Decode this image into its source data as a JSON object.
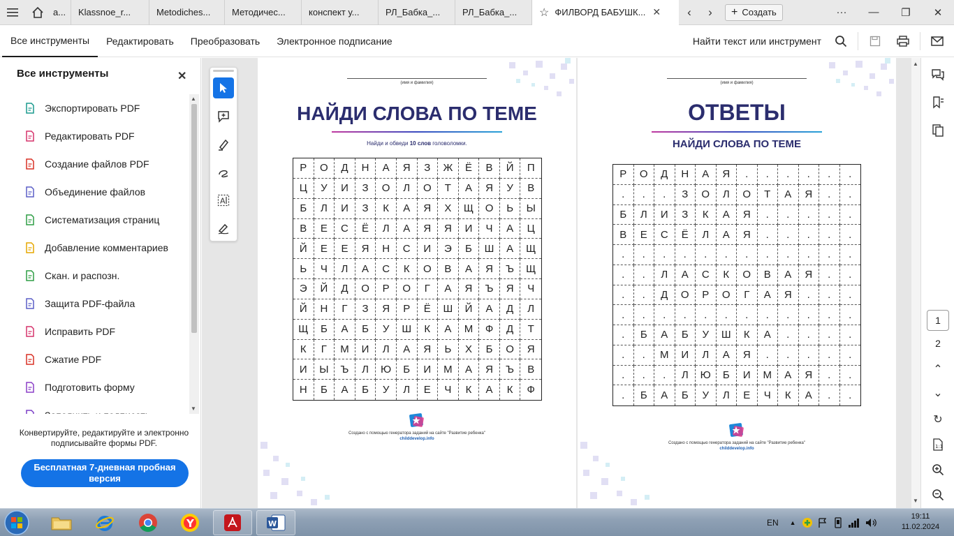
{
  "tabs": {
    "partial": "a...",
    "items": [
      "Klassnoe_r...",
      "Metodiches...",
      "Методичес...",
      "конспект у...",
      "РЛ_Бабка_...",
      "РЛ_Бабка_..."
    ],
    "active": "ФИЛВОРД БАБУШК...",
    "create": "Создать"
  },
  "menu": {
    "items": [
      "Все инструменты",
      "Редактировать",
      "Преобразовать",
      "Электронное подписание"
    ],
    "find": "Найти текст или инструмент"
  },
  "left_panel": {
    "title": "Все инструменты",
    "tools": [
      {
        "label": "Экспортировать PDF",
        "icon": "export-pdf-icon",
        "color": "#1a9a8e"
      },
      {
        "label": "Редактировать PDF",
        "icon": "edit-pdf-icon",
        "color": "#d6336c"
      },
      {
        "label": "Создание файлов PDF",
        "icon": "create-pdf-icon",
        "color": "#d93025"
      },
      {
        "label": "Объединение файлов",
        "icon": "combine-files-icon",
        "color": "#5b5fc7"
      },
      {
        "label": "Систематизация страниц",
        "icon": "organize-pages-icon",
        "color": "#2e9e45"
      },
      {
        "label": "Добавление комментариев",
        "icon": "comment-icon",
        "color": "#e6a700"
      },
      {
        "label": "Скан. и распозн.",
        "icon": "scan-ocr-icon",
        "color": "#2e9e45"
      },
      {
        "label": "Защита PDF-файла",
        "icon": "protect-pdf-icon",
        "color": "#5b5fc7"
      },
      {
        "label": "Исправить PDF",
        "icon": "redact-pdf-icon",
        "color": "#d6336c"
      },
      {
        "label": "Сжатие PDF",
        "icon": "compress-pdf-icon",
        "color": "#d93025"
      },
      {
        "label": "Подготовить форму",
        "icon": "prepare-form-icon",
        "color": "#8b3fc7"
      },
      {
        "label": "Заполнить и подписать",
        "icon": "fill-sign-icon",
        "color": "#7b3fc7"
      }
    ],
    "promo": "Конвертируйте, редактируйте и электронно подписывайте формы PDF.",
    "trial": "Бесплатная 7-дневная пробная версия"
  },
  "page1": {
    "name_caption": "(имя и фамилия)",
    "title": "НАЙДИ СЛОВА ПО ТЕМЕ",
    "instr_pre": "Найди и обведи ",
    "instr_bold": "10 слов",
    "instr_post": " головоломки.",
    "rows": [
      "РОДНАЯЗЖЁВЙП",
      "ЦУИЗОЛОТАЯУВ",
      "БЛИЗКАЯХЩОЬЫ",
      "ВЕСЁЛАЯЯИЧАЦ",
      "ЙЕЕЯНСИЭБШАЩ",
      "ЬЧЛАСКОВАЯЪЩ",
      "ЭЙДОРОГАЯЪЯЧ",
      "ЙНГЗЯРЁШЙАДЛ",
      "ЩБАБУШКАМФДТ",
      "КГМИЛАЯЬХБОЯ",
      "ИЫЪЛЮБИМАЯЪВ",
      "НБАБУЛЕЧКАКФ"
    ],
    "credit": "Создано с помощью генератора заданий на сайте \"Развитие ребенка\"",
    "site": "childdevelop.info"
  },
  "page2": {
    "name_caption": "(имя и фамилия)",
    "title": "ОТВЕТЫ",
    "subtitle": "НАЙДИ СЛОВА ПО ТЕМЕ",
    "rows": [
      "РОДНАЯ......",
      "...ЗОЛОТАЯ..",
      "БЛИЗКАЯ.....",
      "ВЕСЁЛАЯ.....",
      "............",
      "..ЛАСКОВАЯ..",
      "..ДОРОГАЯ...",
      "............",
      ".БАБУШКА....",
      "..МИЛАЯ.....",
      "...ЛЮБИМАЯ..",
      ".БАБУЛЕЧКА.."
    ],
    "credit": "Создано с помощью генератора заданий на сайте \"Развитие ребенка\"",
    "site": "childdevelop.info"
  },
  "pages": {
    "current": "1",
    "other": "2"
  },
  "tray": {
    "lang": "EN",
    "time": "19:11",
    "date": "11.02.2024"
  }
}
